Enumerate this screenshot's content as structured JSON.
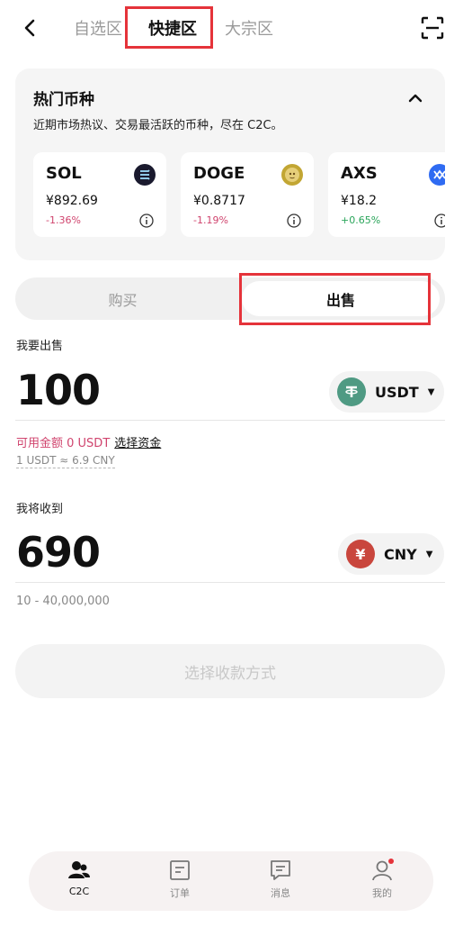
{
  "header": {
    "tabs": [
      {
        "label": "自选区",
        "active": false
      },
      {
        "label": "快捷区",
        "active": true
      },
      {
        "label": "大宗区",
        "active": false
      }
    ]
  },
  "hot": {
    "title": "热门币种",
    "subtitle": "近期市场热议、交易最活跃的币种，尽在 C2C。",
    "coins": [
      {
        "symbol": "SOL",
        "price": "¥892.69",
        "change": "-1.36%",
        "direction": "down",
        "icon": "solana-icon",
        "icon_color": "#1a1a2e"
      },
      {
        "symbol": "DOGE",
        "price": "¥0.8717",
        "change": "-1.19%",
        "direction": "down",
        "icon": "doge-icon",
        "icon_color": "#c2a633"
      },
      {
        "symbol": "AXS",
        "price": "¥18.2",
        "change": "+0.65%",
        "direction": "up",
        "icon": "axs-icon",
        "icon_color": "#2f6bf2"
      }
    ]
  },
  "trade": {
    "buy_label": "购买",
    "sell_label": "出售",
    "active": "sell",
    "sell_section_label": "我要出售",
    "sell_amount": "100",
    "sell_currency": "USDT",
    "available_text": "可用金额 0 USDT",
    "select_funds": "选择资金",
    "rate_text": "1 USDT ≈ 6.9 CNY",
    "receive_label": "我将收到",
    "receive_amount": "690",
    "receive_currency": "CNY",
    "range_text": "10 - 40,000,000",
    "choose_method": "选择收款方式"
  },
  "nav": [
    {
      "label": "C2C",
      "icon": "people-icon",
      "active": true
    },
    {
      "label": "订单",
      "icon": "order-icon",
      "active": false
    },
    {
      "label": "消息",
      "icon": "message-icon",
      "active": false
    },
    {
      "label": "我的",
      "icon": "profile-icon",
      "active": false,
      "badge": true
    }
  ],
  "colors": {
    "highlight": "#e5333a",
    "down": "#d0446e",
    "up": "#2aa55a",
    "usdt": "#4f9a83",
    "cny": "#c9463d"
  }
}
